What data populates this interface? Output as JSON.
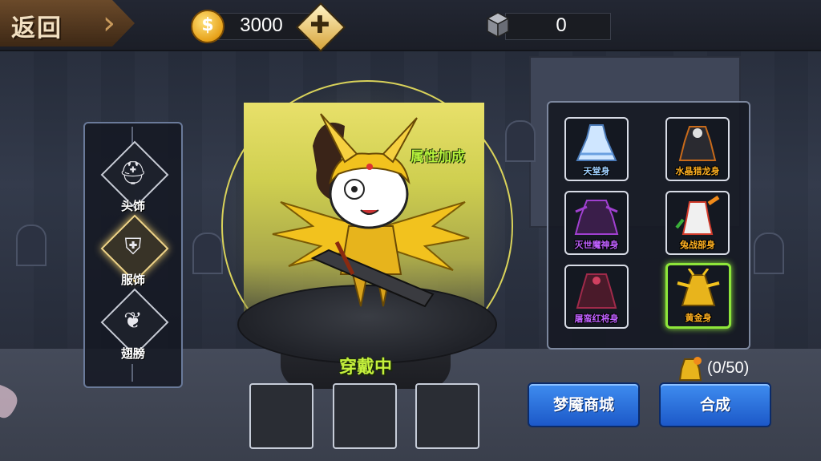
{
  "topbar": {
    "back_label": "返回",
    "coins": "3000",
    "gems": "0"
  },
  "categories": [
    {
      "label": "头饰",
      "icon": "helmet-icon",
      "active": false
    },
    {
      "label": "服饰",
      "icon": "armor-icon",
      "active": true
    },
    {
      "label": "翅膀",
      "icon": "wing-icon",
      "active": false
    }
  ],
  "stage": {
    "attr_label": "属性加成",
    "wearing_label": "穿戴中"
  },
  "costumes": [
    {
      "label": "天堂身",
      "color": "#9fd0ff"
    },
    {
      "label": "水晶猎龙身",
      "color": "#ffb020"
    },
    {
      "label": "灭世魔神身",
      "color": "#c060ff"
    },
    {
      "label": "兔战部身",
      "color": "#ffb020"
    },
    {
      "label": "屠蛮红将身",
      "color": "#c060ff"
    },
    {
      "label": "黄金身",
      "color": "#ffb020"
    }
  ],
  "fragments": "(0/50)",
  "buttons": {
    "shop": "梦魇商城",
    "craft": "合成"
  },
  "colors": {
    "accent_green": "#8ee63a",
    "button_blue": "#1c58c8"
  }
}
